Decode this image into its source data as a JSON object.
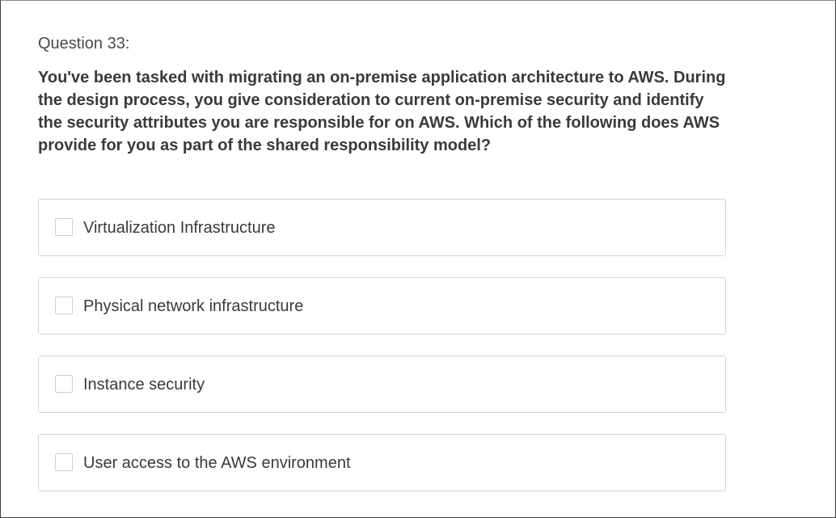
{
  "question": {
    "number_label": "Question 33:",
    "text": "You've been tasked with migrating an on-premise application architecture to AWS. During the design process, you give consideration to current on-premise security and identify the security attributes you are responsible for on AWS. Which of the following does AWS provide for you as part of the shared responsibility model?"
  },
  "options": [
    {
      "label": "Virtualization Infrastructure",
      "checked": false
    },
    {
      "label": "Physical network infrastructure",
      "checked": false
    },
    {
      "label": "Instance security",
      "checked": false
    },
    {
      "label": "User access to the AWS environment",
      "checked": false
    }
  ]
}
